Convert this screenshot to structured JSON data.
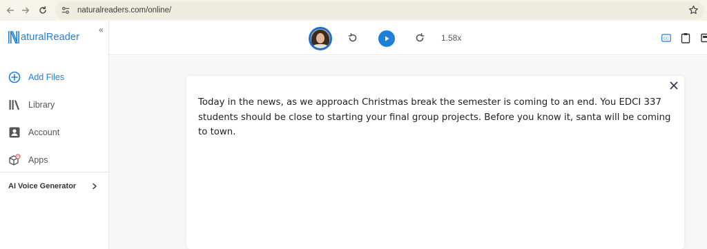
{
  "browser": {
    "url": "naturalreaders.com/online/"
  },
  "sidebar": {
    "logo_text": "NaturalReader",
    "logo_n": "N",
    "logo_rest": "aturalReader",
    "collapse_label": "«",
    "items": [
      {
        "label": "Add Files",
        "icon": "add-circle-icon",
        "active": true
      },
      {
        "label": "Library",
        "icon": "library-icon",
        "active": false
      },
      {
        "label": "Account",
        "icon": "account-icon",
        "active": false
      },
      {
        "label": "Apps",
        "icon": "apps-icon",
        "active": false
      }
    ],
    "voice_generator": {
      "label": "AI Voice Generator",
      "icon": "chevron-right-icon"
    }
  },
  "player": {
    "speed": "1.58x",
    "icons": [
      "rewind-icon",
      "play-icon",
      "forward-icon"
    ],
    "right_icons": [
      "cc-icon",
      "clipboard-icon",
      "window-icon"
    ],
    "cc_label": "CC"
  },
  "document": {
    "text": "Today in the news, as we approach Christmas break the semester is coming to an end. You EDCI 337 students should be close to starting your final group projects. Before you know it, santa will be coming to town."
  },
  "colors": {
    "accent": "#1e7fd9",
    "browser_bar": "#f5f3ea"
  }
}
